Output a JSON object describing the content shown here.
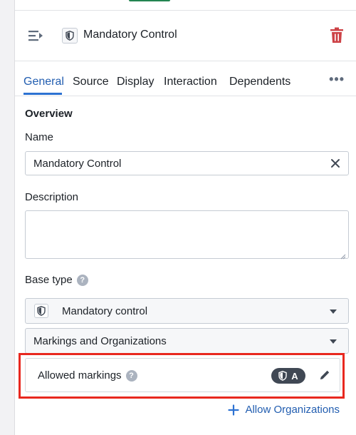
{
  "header": {
    "title": "Mandatory Control",
    "collapse_icon": "collapse-panel-icon",
    "type_icon": "shield-icon",
    "delete_icon": "trash-icon"
  },
  "tabs": [
    {
      "label": "General",
      "active": true
    },
    {
      "label": "Source"
    },
    {
      "label": "Display"
    },
    {
      "label": "Interaction"
    },
    {
      "label": "Dependents"
    }
  ],
  "more_menu_label": "•••",
  "overview": {
    "section_title": "Overview",
    "name_label": "Name",
    "name_value": "Mandatory Control",
    "description_label": "Description",
    "description_value": "",
    "base_type_label": "Base type",
    "base_type_value": "Mandatory control",
    "secondary_select_value": "Markings and Organizations",
    "allowed_markings_label": "Allowed markings",
    "marking_tag_text": "A",
    "allow_orgs_label": "Allow Organizations"
  },
  "help_glyph": "?",
  "colors": {
    "accent": "#2d72d2",
    "danger": "#cd4246",
    "highlight": "#e8281f",
    "tag_bg": "#404854"
  }
}
